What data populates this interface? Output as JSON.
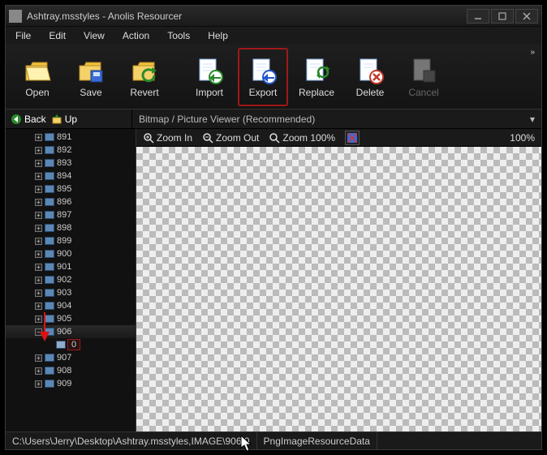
{
  "window": {
    "title": "Ashtray.msstyles - Anolis Resourcer"
  },
  "menu": {
    "file": "File",
    "edit": "Edit",
    "view": "View",
    "action": "Action",
    "tools": "Tools",
    "help": "Help"
  },
  "toolbar": {
    "open": "Open",
    "save": "Save",
    "revert": "Revert",
    "import": "Import",
    "export": "Export",
    "replace": "Replace",
    "delete": "Delete",
    "cancel": "Cancel"
  },
  "nav": {
    "back": "Back",
    "up": "Up"
  },
  "viewer": {
    "selector": "Bitmap / Picture Viewer (Recommended)",
    "zoom_in": "Zoom In",
    "zoom_out": "Zoom Out",
    "zoom_100": "Zoom 100%",
    "zoom_value": "100%"
  },
  "tree": {
    "items": [
      {
        "id": "891",
        "expanded": false
      },
      {
        "id": "892",
        "expanded": false
      },
      {
        "id": "893",
        "expanded": false
      },
      {
        "id": "894",
        "expanded": false
      },
      {
        "id": "895",
        "expanded": false
      },
      {
        "id": "896",
        "expanded": false
      },
      {
        "id": "897",
        "expanded": false
      },
      {
        "id": "898",
        "expanded": false
      },
      {
        "id": "899",
        "expanded": false
      },
      {
        "id": "900",
        "expanded": false
      },
      {
        "id": "901",
        "expanded": false
      },
      {
        "id": "902",
        "expanded": false
      },
      {
        "id": "903",
        "expanded": false
      },
      {
        "id": "904",
        "expanded": false
      },
      {
        "id": "905",
        "expanded": false
      },
      {
        "id": "906",
        "expanded": true,
        "children": [
          {
            "id": "0",
            "selected": true
          }
        ]
      },
      {
        "id": "907",
        "expanded": false
      },
      {
        "id": "908",
        "expanded": false
      },
      {
        "id": "909",
        "expanded": false
      }
    ]
  },
  "status": {
    "path": "C:\\Users\\Jerry\\Desktop\\Ashtray.msstyles,IMAGE\\906\\0",
    "type": "PngImageResourceData"
  }
}
